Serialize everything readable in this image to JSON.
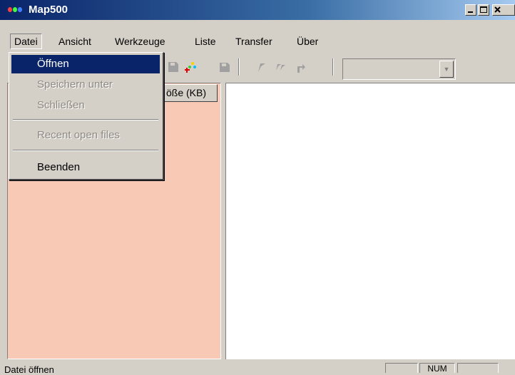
{
  "window": {
    "title": "Map500"
  },
  "menubar": {
    "items": [
      "Datei",
      "Ansicht",
      "Werkzeuge",
      "Liste",
      "Transfer",
      "Über"
    ],
    "active": "Datei"
  },
  "file_menu": {
    "items": [
      {
        "label": "Öffnen",
        "state": "selected"
      },
      {
        "label": "Speichern unter",
        "state": "disabled"
      },
      {
        "label": "Schließen",
        "state": "disabled"
      },
      {
        "label": "Recent open files",
        "state": "disabled"
      },
      {
        "label": "Beenden",
        "state": "enabled"
      }
    ]
  },
  "list": {
    "column_header_partial": "öße (KB)"
  },
  "toolbar": {
    "combo_value": ""
  },
  "statusbar": {
    "text": "Datei öffnen",
    "num_indicator": "NUM"
  },
  "colors": {
    "title_gradient_start": "#0a246a",
    "menu_highlight": "#0a246a",
    "list_background": "#f8c9b4",
    "chrome": "#d4d0c8"
  }
}
